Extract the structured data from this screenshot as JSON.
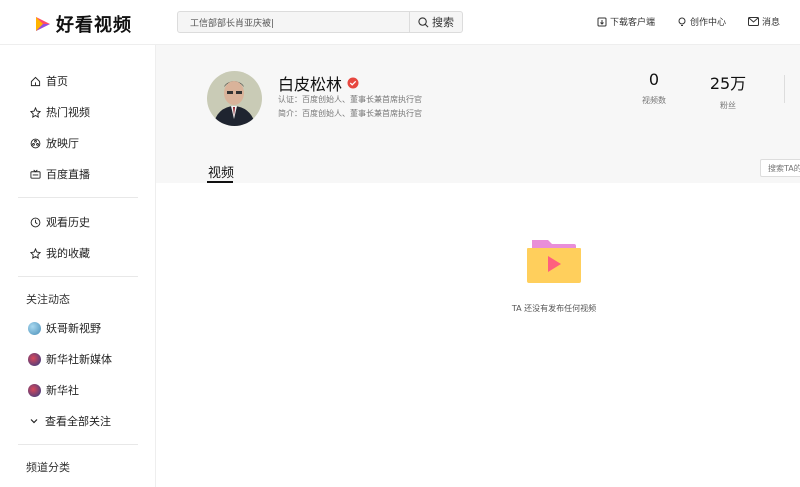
{
  "header": {
    "logo_text": "好看视频",
    "search": {
      "value": "工信部部长肖亚庆被|",
      "button_label": "搜索"
    },
    "links": [
      {
        "label": "下载客户端",
        "icon": "download-icon"
      },
      {
        "label": "创作中心",
        "icon": "bulb-icon"
      },
      {
        "label": "消息",
        "icon": "mail-icon"
      }
    ]
  },
  "sidebar": {
    "nav": [
      {
        "label": "首页",
        "icon": "home-icon"
      },
      {
        "label": "热门视频",
        "icon": "hot-icon"
      },
      {
        "label": "放映厅",
        "icon": "cinema-icon"
      },
      {
        "label": "百度直播",
        "icon": "live-icon"
      }
    ],
    "personal": [
      {
        "label": "观看历史",
        "icon": "clock-icon"
      },
      {
        "label": "我的收藏",
        "icon": "star-icon"
      }
    ],
    "follow_title": "关注动态",
    "follows": [
      {
        "label": "妖哥新视野"
      },
      {
        "label": "新华社新媒体"
      },
      {
        "label": "新华社"
      }
    ],
    "view_all": "查看全部关注",
    "category_title": "频道分类"
  },
  "profile": {
    "name": "白皮松林",
    "cert": "认证：百度创始人、董事长兼首席执行官",
    "intro": "简介：百度创始人、董事长兼首席执行官",
    "stats": [
      {
        "value": "0",
        "label": "视频数"
      },
      {
        "value": "25万",
        "label": "粉丝"
      }
    ],
    "tab": "视频",
    "tab_search_placeholder": "搜索TA的",
    "empty_text": "TA 还没有发布任何视频"
  },
  "colors": {
    "accent": "#e7473f",
    "folder": "#ffcf5c",
    "folder_back": "#e98ed8"
  }
}
